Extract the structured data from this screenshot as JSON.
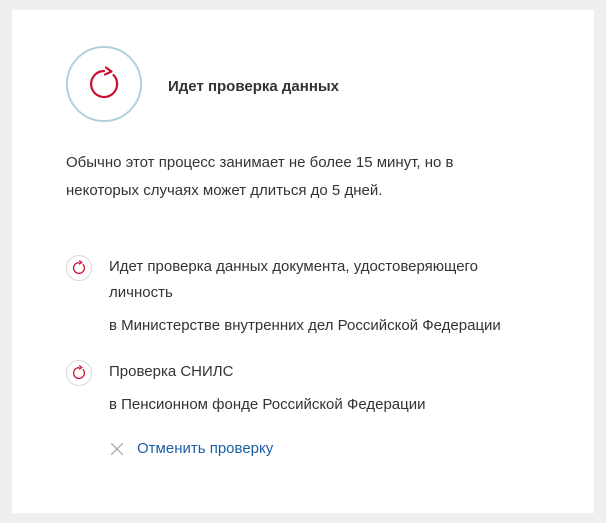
{
  "status": {
    "title": "Идет проверка данных",
    "description": "Обычно этот процесс занимает не более 15 минут, но в некоторых случаях может длиться до 5 дней.",
    "icon": "refresh-icon"
  },
  "checks": [
    {
      "title": "Идет проверка данных документа, удостоверяющего личность",
      "organization": "в Министерстве внутренних дел Российской Федерации",
      "icon": "refresh-icon"
    },
    {
      "title": "Проверка СНИЛС",
      "organization": "в Пенсионном фонде Российской Федерации",
      "icon": "refresh-icon"
    }
  ],
  "cancel": {
    "label": "Отменить проверку",
    "icon": "close-icon"
  },
  "colors": {
    "accent_red": "#c8102e",
    "link_blue": "#1b5fa3",
    "icon_ring": "#b3cfe0"
  }
}
